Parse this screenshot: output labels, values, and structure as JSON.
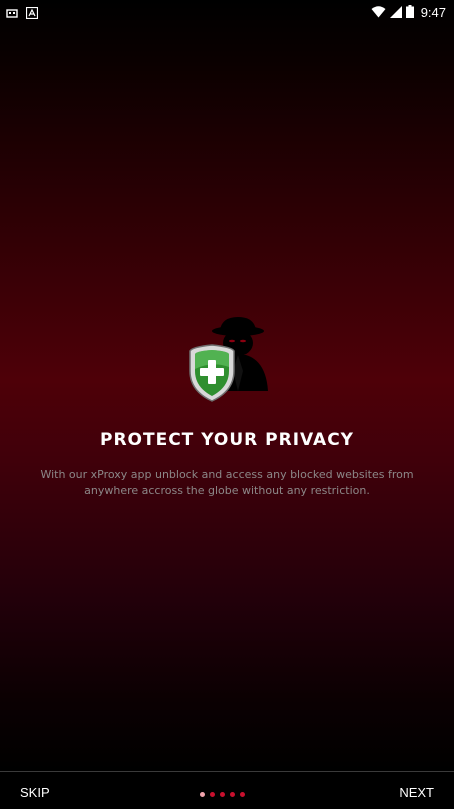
{
  "status_bar": {
    "time": "9:47",
    "left_icons": [
      "usb-icon",
      "notification-a-icon"
    ],
    "right_icons": [
      "wifi-icon",
      "cell-signal-icon",
      "battery-icon"
    ]
  },
  "slide": {
    "title": "PROTECT YOUR PRIVACY",
    "description": "With our xProxy app unblock and access any blocked websites from anywhere accross the globe without any restriction.",
    "illustration": "spy-shield-icon"
  },
  "pager": {
    "total": 5,
    "active_index": 0
  },
  "buttons": {
    "skip": "SKIP",
    "next": "NEXT"
  },
  "colors": {
    "accent": "#c8102e",
    "active_dot": "#f2a4ad",
    "background_red": "#4e0008",
    "shield_green": "#3a9e3a"
  }
}
